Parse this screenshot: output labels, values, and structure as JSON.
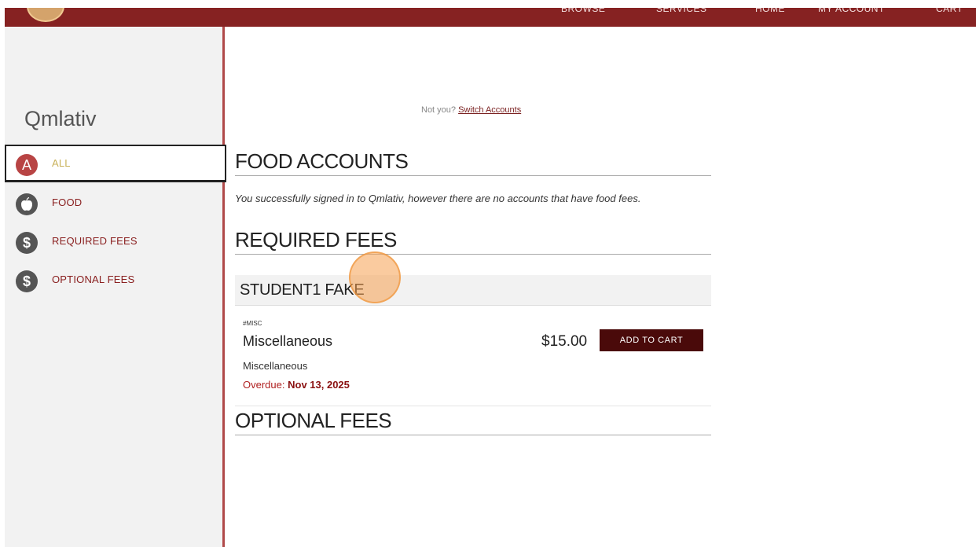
{
  "nav": {
    "items": [
      "BROWSE",
      "SERVICES",
      "HOME",
      "MY ACCOUNT",
      "CART"
    ]
  },
  "sidebar": {
    "brand": "Qmlativ",
    "items": [
      {
        "badge": "A",
        "label": "ALL",
        "icon": "letter-a-icon",
        "active": true
      },
      {
        "badge": "",
        "label": "FOOD",
        "icon": "apple-icon",
        "active": false
      },
      {
        "badge": "$",
        "label": "REQUIRED FEES",
        "icon": "dollar-icon",
        "active": false
      },
      {
        "badge": "$",
        "label": "OPTIONAL FEES",
        "icon": "dollar-icon",
        "active": false
      }
    ]
  },
  "account": {
    "not_you": "Not you?",
    "switch_link": "Switch Accounts"
  },
  "food": {
    "title": "FOOD ACCOUNTS",
    "message": "You successfully signed in to Qmlativ, however there are no accounts that have food fees."
  },
  "required": {
    "title": "REQUIRED FEES",
    "student": "STUDENT1 FAKE",
    "fee": {
      "code": "#MISC",
      "name": "Miscellaneous",
      "description": "Miscellaneous",
      "due_label": "Overdue:",
      "due_date": "Nov 13, 2025",
      "price": "$15.00",
      "button": "ADD TO CART"
    }
  },
  "optional": {
    "title": "OPTIONAL FEES"
  },
  "colors": {
    "brand": "#862222",
    "button": "#4a0a0a",
    "active_label": "#c9b25a"
  }
}
